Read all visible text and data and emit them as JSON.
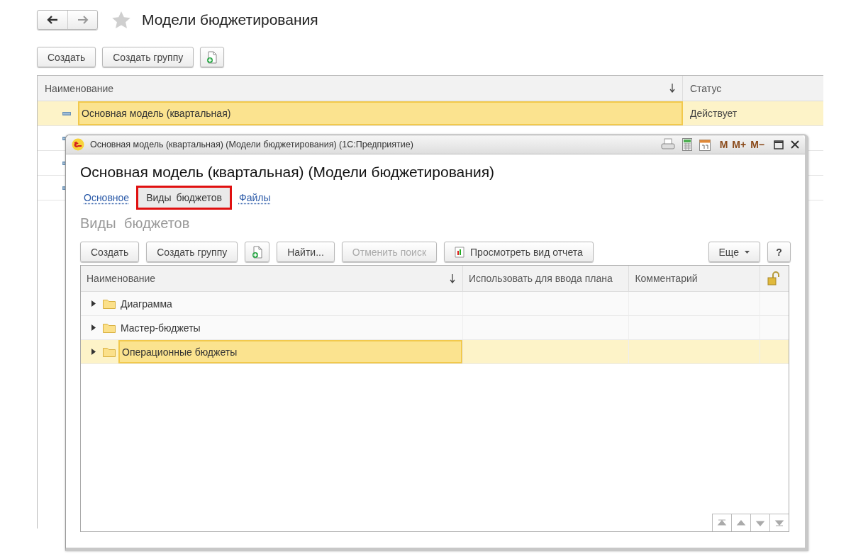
{
  "page": {
    "title": "Модели бюджетирования"
  },
  "toolbar": [
    {
      "kind": "text",
      "label": "Создать"
    },
    {
      "kind": "text",
      "label": "Создать группу"
    },
    {
      "kind": "add-file"
    }
  ],
  "table": {
    "columns": [
      {
        "label": "Наименование",
        "sorted": true
      },
      {
        "label": "Статус",
        "sorted": false
      }
    ],
    "rows": [
      {
        "name": "Основная модель (квартальная)",
        "status": "Действует",
        "selected": true
      },
      {
        "selected": false
      },
      {
        "selected": false
      },
      {
        "selected": false
      }
    ]
  },
  "dialog": {
    "title": "Основная модель (квартальная) (Модели бюджетирования)  (1С:Предприятие)",
    "memory_buttons": [
      "M",
      "M+",
      "M−"
    ],
    "header": "Основная модель (квартальная) (Модели бюджетирования)",
    "tabs": [
      {
        "label": "Основное",
        "selected": false,
        "highlighted": false
      },
      {
        "label": "Виды  бюджетов",
        "selected": true,
        "highlighted": true
      },
      {
        "label": "Файлы",
        "selected": false,
        "highlighted": false
      }
    ],
    "section_title": "Виды  бюджетов",
    "toolbar": [
      {
        "kind": "text",
        "label": "Создать",
        "disabled": false
      },
      {
        "kind": "text",
        "label": "Создать группу",
        "disabled": false
      },
      {
        "kind": "add-file",
        "disabled": false
      },
      {
        "kind": "text",
        "label": "Найти...",
        "disabled": false
      },
      {
        "kind": "text",
        "label": "Отменить поиск",
        "disabled": true
      },
      {
        "kind": "report",
        "label": "Просмотреть вид отчета",
        "disabled": false
      }
    ],
    "more": "Еще",
    "help": "?",
    "table": {
      "columns": [
        {
          "kind": "text",
          "label": "Наименование",
          "sorted": true
        },
        {
          "kind": "text",
          "label": "Использовать для ввода плана",
          "sorted": false
        },
        {
          "kind": "text",
          "label": "Комментарий",
          "sorted": false
        },
        {
          "kind": "lock",
          "sorted": false
        }
      ],
      "rows": [
        {
          "name": "Диаграмма",
          "selected": false
        },
        {
          "name": "Мастер-бюджеты",
          "selected": false
        },
        {
          "name": "Операционные бюджеты",
          "selected": true
        }
      ]
    }
  }
}
